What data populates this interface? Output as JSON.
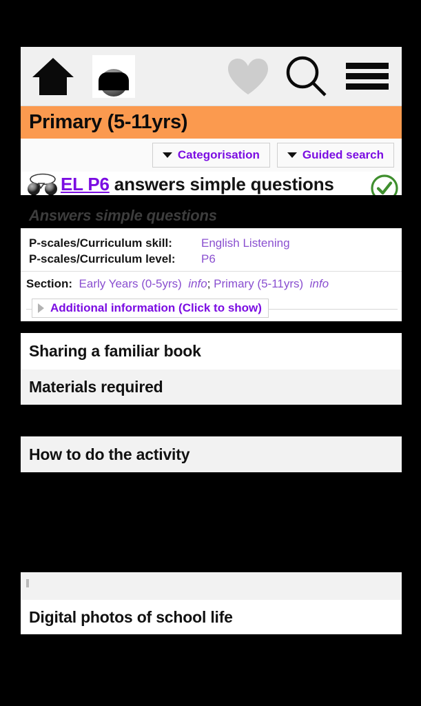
{
  "app": {
    "top_bar": {
      "home_icon": "home-icon",
      "avatar_icon": "user-avatar-icon",
      "favourite_icon": "heart-icon",
      "search_icon": "search-icon",
      "menu_icon": "hamburger-menu-icon"
    },
    "page_title": "Primary (5-11yrs)",
    "accent_orange": "#fb9a4f",
    "accent_purple": "#7b0de2",
    "link_purple": "#8a4fd0",
    "status_green": "#3f8f2e"
  },
  "toolbar": {
    "categorisation_label": "Categorisation",
    "guided_search_label": "Guided search"
  },
  "heading": {
    "people_icon": "two-people-talking-icon",
    "code": "EL P6",
    "text": " answers simple questions",
    "status_icon": "green-check-circle-icon",
    "subtitle": "Answers simple questions"
  },
  "meta": {
    "rows": [
      {
        "label": "P-scales/Curriculum skill:",
        "value": "English Listening"
      },
      {
        "label": "P-scales/Curriculum level:",
        "value": "P6"
      }
    ],
    "section_label": "Section:",
    "section_links": [
      {
        "name": "Early Years (0-5yrs)",
        "info": "info"
      },
      {
        "name": "Primary (5-11yrs)",
        "info": "info"
      }
    ],
    "section_separator": "; ",
    "additional_info_label": "Additional information (Click to show)",
    "additional_info_caret": "caret-right-icon"
  },
  "content": {
    "sections": [
      {
        "title": "Sharing a familiar book",
        "style": "white"
      },
      {
        "title": "Materials required",
        "style": "gray"
      },
      {
        "title": "How to do the activity",
        "style": "gray"
      },
      {
        "title": "Digital photos of school life",
        "style": "white"
      }
    ]
  }
}
